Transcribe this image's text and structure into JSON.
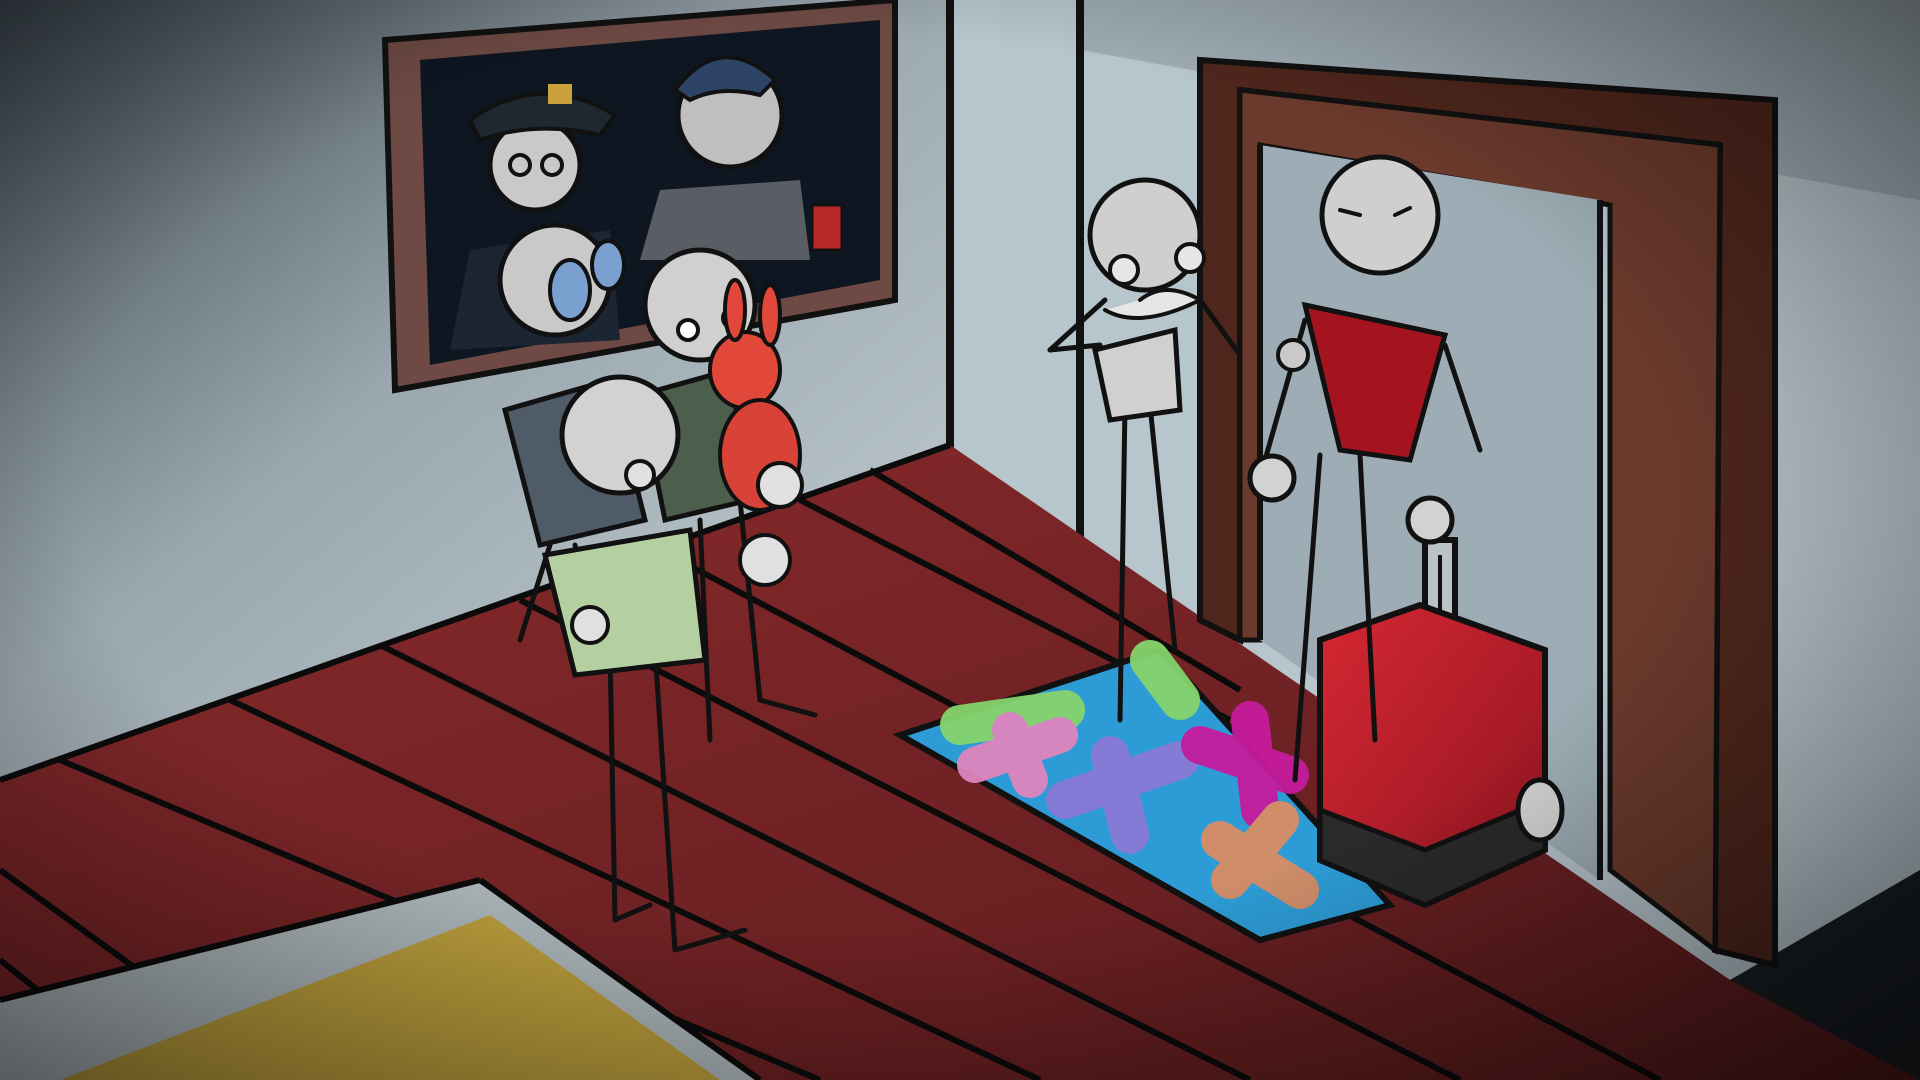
{
  "scene": {
    "type": "illustrated-game-scene",
    "colors": {
      "wall": "#8a959d",
      "wall_light": "#c7d3d9",
      "shadow": "#1d252c",
      "floor": "#7a2426",
      "floor_line": "#0d0d0d",
      "door_frame": "#5a2e24",
      "suitcase": "#c2202b",
      "rug_base": "#2d9cd6",
      "rug_green": "#86d36c",
      "rug_pink": "#e085be",
      "rug_magenta": "#c61b9d",
      "rug_purple": "#8a7ad8",
      "rug_orange": "#d88d64",
      "plush_bunny": "#e1483a",
      "red_shirt": "#a5131f",
      "yellow_floor": "#b89b3b"
    },
    "objects": {
      "framed_photo": "framed-photo",
      "doorway": "doorway",
      "suitcase": "suitcase",
      "rug": "rug",
      "plush_bunny": "plush-bunny"
    }
  }
}
